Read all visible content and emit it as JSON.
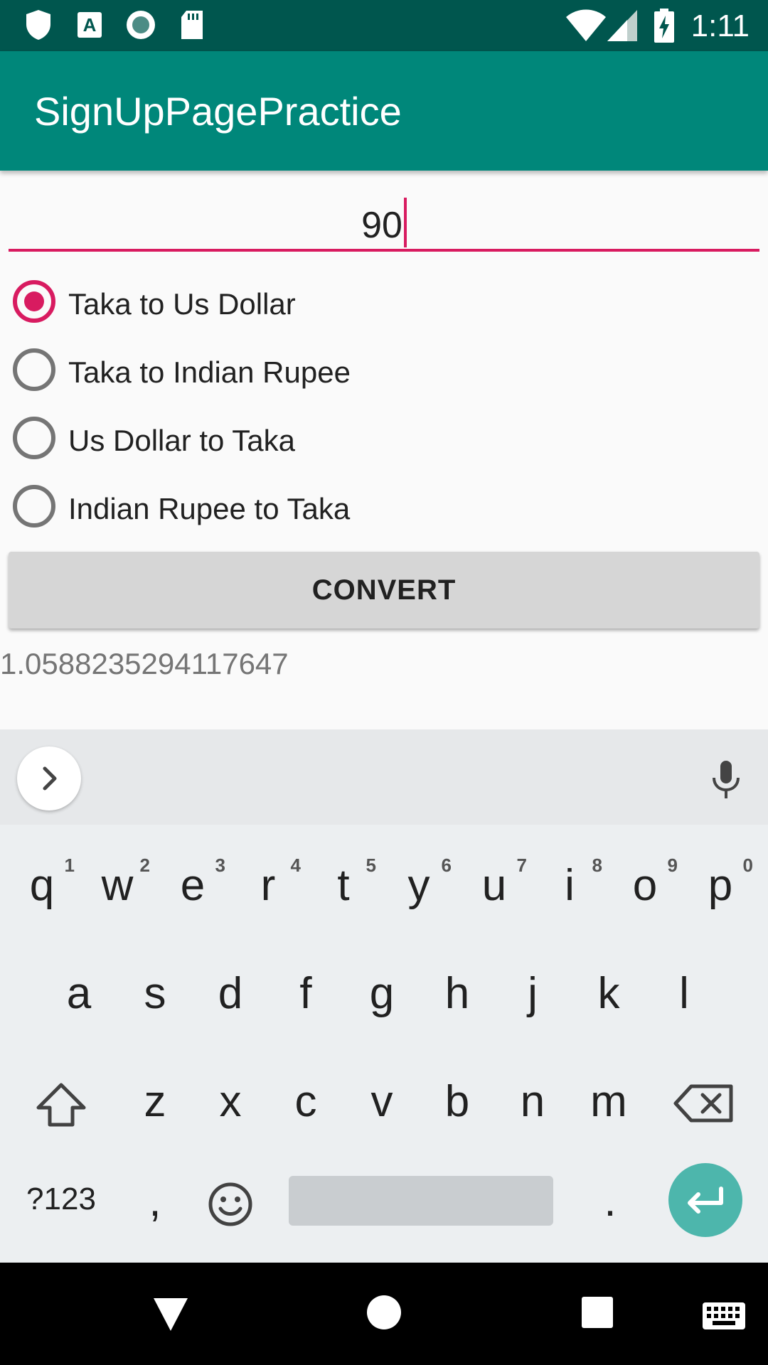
{
  "status_bar": {
    "time": "1:11",
    "left_icons": [
      "shield-icon",
      "text-a-icon",
      "record-icon",
      "sd-card-icon"
    ],
    "right_icons": [
      "wifi-icon",
      "cell-signal-icon",
      "battery-charging-icon"
    ]
  },
  "app_bar": {
    "title": "SignUpPagePractice",
    "color": "#00877a"
  },
  "amount_input": {
    "value": "90"
  },
  "radio_options": [
    {
      "label": "Taka to Us Dollar",
      "checked": true
    },
    {
      "label": "Taka to Indian Rupee",
      "checked": false
    },
    {
      "label": "Us Dollar to Taka",
      "checked": false
    },
    {
      "label": "Indian Rupee to Taka",
      "checked": false
    }
  ],
  "convert_button": {
    "label": "CONVERT"
  },
  "result": {
    "value": "1.0588235294117647"
  },
  "keyboard": {
    "row1": [
      {
        "key": "q",
        "hint": "1"
      },
      {
        "key": "w",
        "hint": "2"
      },
      {
        "key": "e",
        "hint": "3"
      },
      {
        "key": "r",
        "hint": "4"
      },
      {
        "key": "t",
        "hint": "5"
      },
      {
        "key": "y",
        "hint": "6"
      },
      {
        "key": "u",
        "hint": "7"
      },
      {
        "key": "i",
        "hint": "8"
      },
      {
        "key": "o",
        "hint": "9"
      },
      {
        "key": "p",
        "hint": "0"
      }
    ],
    "row2": [
      "a",
      "s",
      "d",
      "f",
      "g",
      "h",
      "j",
      "k",
      "l"
    ],
    "row3": [
      "z",
      "x",
      "c",
      "v",
      "b",
      "n",
      "m"
    ],
    "symbols_label": "?123",
    "comma": ",",
    "period": ".",
    "accent": "#4db6ac"
  },
  "nav_bar": {
    "icons": [
      "back-icon",
      "home-icon",
      "recents-icon",
      "keyboard-switch-icon"
    ]
  },
  "colors": {
    "accent": "#d81b60",
    "status_bar": "#00564e"
  }
}
